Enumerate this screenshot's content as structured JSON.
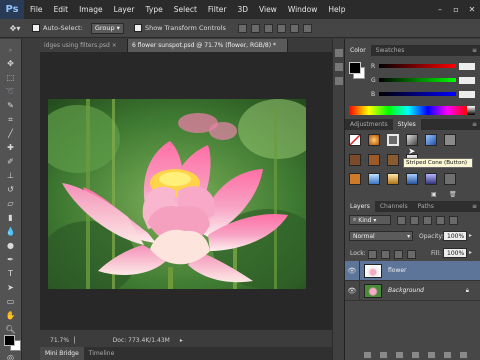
{
  "menubar": {
    "logo": "Ps",
    "items": [
      "File",
      "Edit",
      "Image",
      "Layer",
      "Type",
      "Select",
      "Filter",
      "3D",
      "View",
      "Window",
      "Help"
    ],
    "window_controls": [
      "–",
      "▫",
      "✕"
    ]
  },
  "options": {
    "auto_select_label": "Auto-Select:",
    "auto_select_value": "Group",
    "show_transform_label": "Show Transform Controls"
  },
  "documents": {
    "tabs": [
      "idges using filters.psd ×",
      "6 flower sunspot.psd @ 71.7% (flower, RGB/8) *"
    ]
  },
  "status": {
    "zoom": "71.7%",
    "doc": "Doc: 773.4K/1.43M"
  },
  "bottom_tabs": [
    "Mini Bridge",
    "Timeline"
  ],
  "color_panel": {
    "tabs": [
      "Color",
      "Swatches"
    ],
    "slider_labels": [
      "R",
      "G",
      "B"
    ],
    "foreground": "#000000",
    "background": "#ffffff"
  },
  "styles_panel": {
    "tabs": [
      "Adjustments",
      "Styles"
    ],
    "tooltip": "Striped Cone (Button)"
  },
  "layers_panel": {
    "tabs": [
      "Layers",
      "Channels",
      "Paths"
    ],
    "kind": "Kind",
    "blend_mode": "Normal",
    "opacity_label": "Opacity:",
    "opacity_value": "100%",
    "lock_label": "Lock:",
    "fill_label": "Fill:",
    "fill_value": "100%",
    "layers": [
      {
        "name": "flower",
        "selected": true
      },
      {
        "name": "Background",
        "selected": false
      }
    ]
  },
  "colors": {
    "accent": "#5c7598",
    "chrome_dark": "#2b2b2b",
    "panel": "#474747"
  }
}
